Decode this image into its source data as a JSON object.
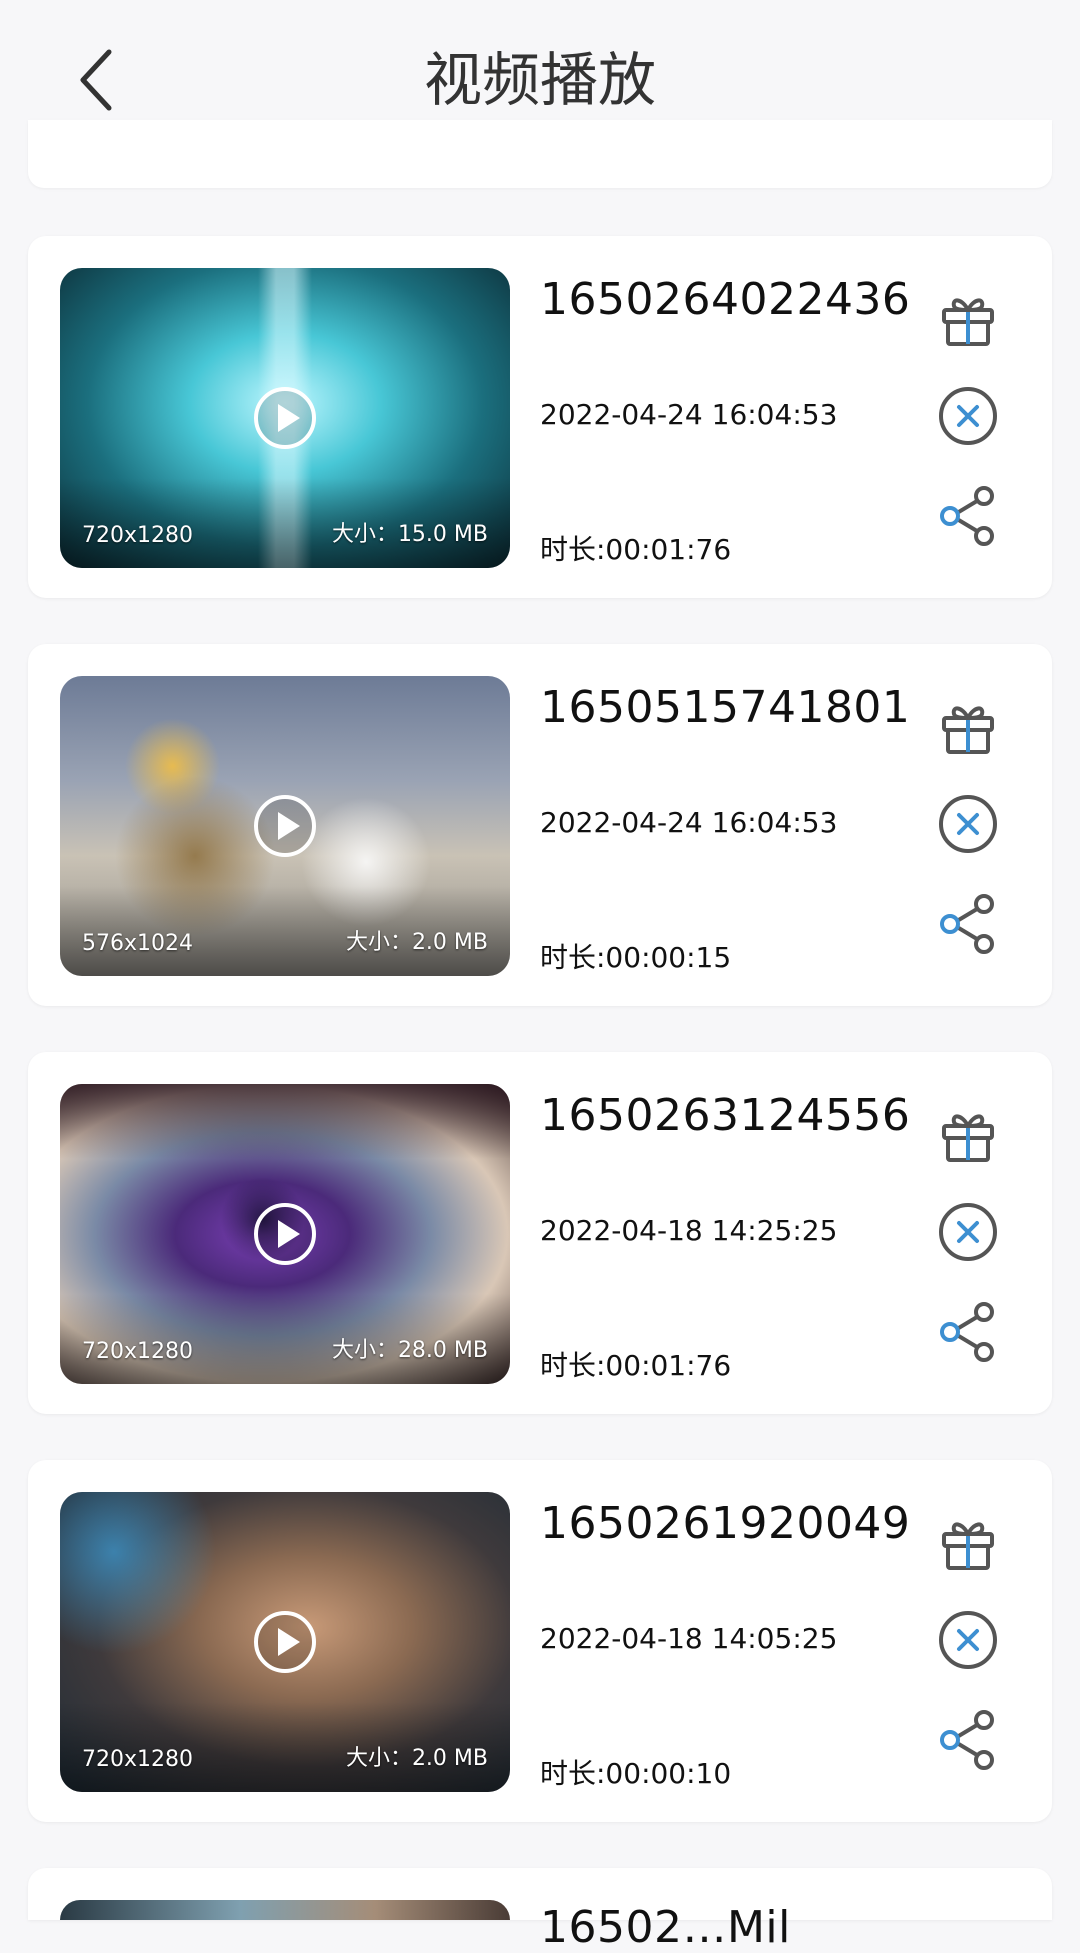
{
  "header": {
    "title": "视频播放"
  },
  "videos": [
    {
      "name": "1650264022436",
      "date": "2022-04-24 16:04:53",
      "duration": "时长:00:01:76",
      "resolution": "720x1280",
      "size": "大小：15.0 MB"
    },
    {
      "name": "1650515741801",
      "date": "2022-04-24 16:04:53",
      "duration": "时长:00:00:15",
      "resolution": "576x1024",
      "size": "大小：2.0 MB"
    },
    {
      "name": "1650263124556",
      "date": "2022-04-18 14:25:25",
      "duration": "时长:00:01:76",
      "resolution": "720x1280",
      "size": "大小：28.0 MB"
    },
    {
      "name": "1650261920049",
      "date": "2022-04-18 14:05:25",
      "duration": "时长:00:00:10",
      "resolution": "720x1280",
      "size": "大小：2.0 MB"
    },
    {
      "name": "16502…Mil",
      "date": "",
      "duration": "",
      "resolution": "",
      "size": ""
    }
  ],
  "colors": {
    "icon_gray": "#555555",
    "icon_blue": "#3d8fd1",
    "card_bg": "#ffffff",
    "page_bg": "#f7f7f9"
  },
  "icons": {
    "back": "chevron-left-icon",
    "play": "play-circle-icon",
    "gift": "gift-icon",
    "delete": "close-circle-icon",
    "share": "share-icon"
  }
}
